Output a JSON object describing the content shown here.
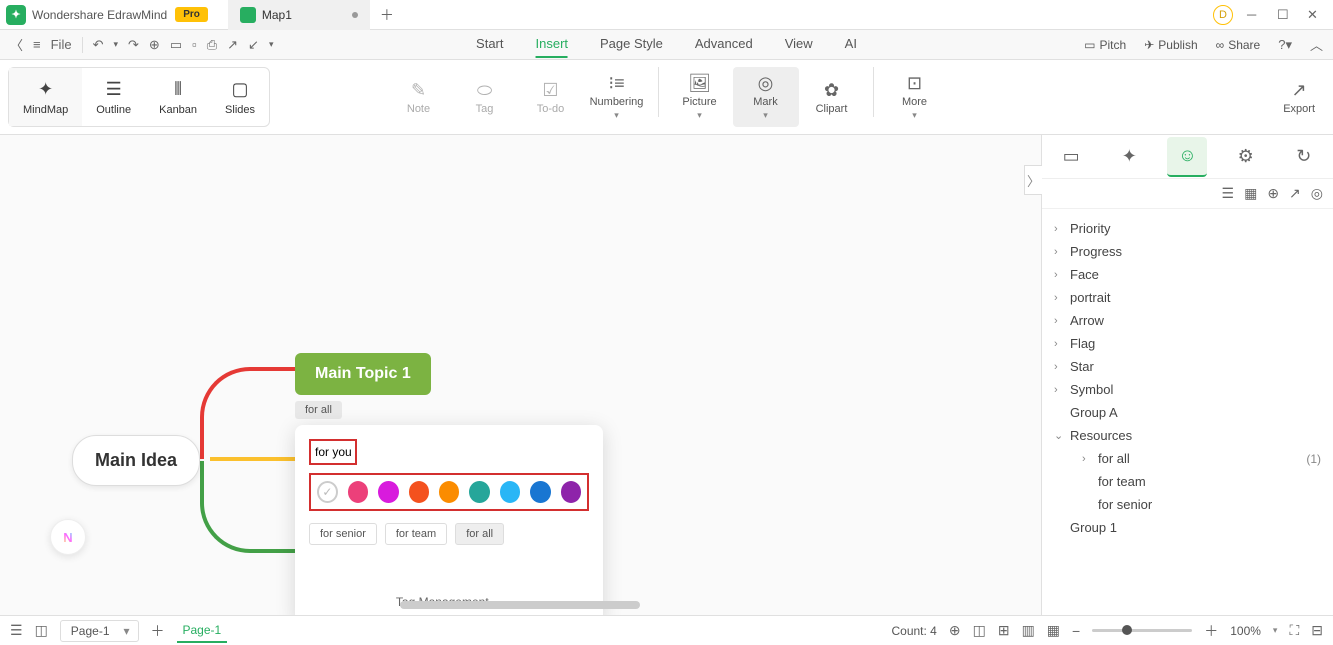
{
  "app": {
    "name": "Wondershare EdrawMind",
    "badge": "Pro",
    "user": "D"
  },
  "tabs": [
    {
      "name": "Map1",
      "modified": true
    }
  ],
  "file_menu": "File",
  "main_menu": [
    "Start",
    "Insert",
    "Page Style",
    "Advanced",
    "View",
    "AI"
  ],
  "active_menu": "Insert",
  "toolbar_actions": {
    "pitch": "Pitch",
    "publish": "Publish",
    "share": "Share"
  },
  "view_modes": [
    {
      "label": "MindMap"
    },
    {
      "label": "Outline"
    },
    {
      "label": "Kanban"
    },
    {
      "label": "Slides"
    }
  ],
  "ribbon_tools": [
    {
      "label": "Note",
      "disabled": true
    },
    {
      "label": "Tag",
      "disabled": true
    },
    {
      "label": "To-do",
      "disabled": true
    },
    {
      "label": "Numbering"
    },
    {
      "label": "Picture"
    },
    {
      "label": "Mark",
      "active": true
    },
    {
      "label": "Clipart"
    },
    {
      "label": "More"
    }
  ],
  "export": "Export",
  "mindmap": {
    "root": "Main Idea",
    "topic": "Main Topic 1",
    "topic_tag": "for all"
  },
  "tag_popup": {
    "input": "for you",
    "colors": [
      "#ec407a",
      "#d81bdd",
      "#f4511e",
      "#fb8c00",
      "#26a69a",
      "#29b6f6",
      "#1976d2",
      "#8e24aa"
    ],
    "chips": [
      {
        "t": "for senior"
      },
      {
        "t": "for team"
      },
      {
        "t": "for all",
        "sel": true
      }
    ],
    "mgmt": "Tag Management"
  },
  "side_tree": {
    "items": [
      "Priority",
      "Progress",
      "Face",
      "portrait",
      "Arrow",
      "Flag",
      "Star",
      "Symbol"
    ],
    "groups": [
      {
        "name": "Group A"
      },
      {
        "name": "Resources",
        "open": true,
        "children": [
          {
            "name": "for all",
            "count": "(1)",
            "chev": true
          },
          {
            "name": "for team"
          },
          {
            "name": "for senior"
          }
        ]
      },
      {
        "name": "Group 1"
      }
    ]
  },
  "status": {
    "count": "Count: 4",
    "page_sel": "Page-1",
    "page_tab": "Page-1",
    "zoom": "100%"
  }
}
